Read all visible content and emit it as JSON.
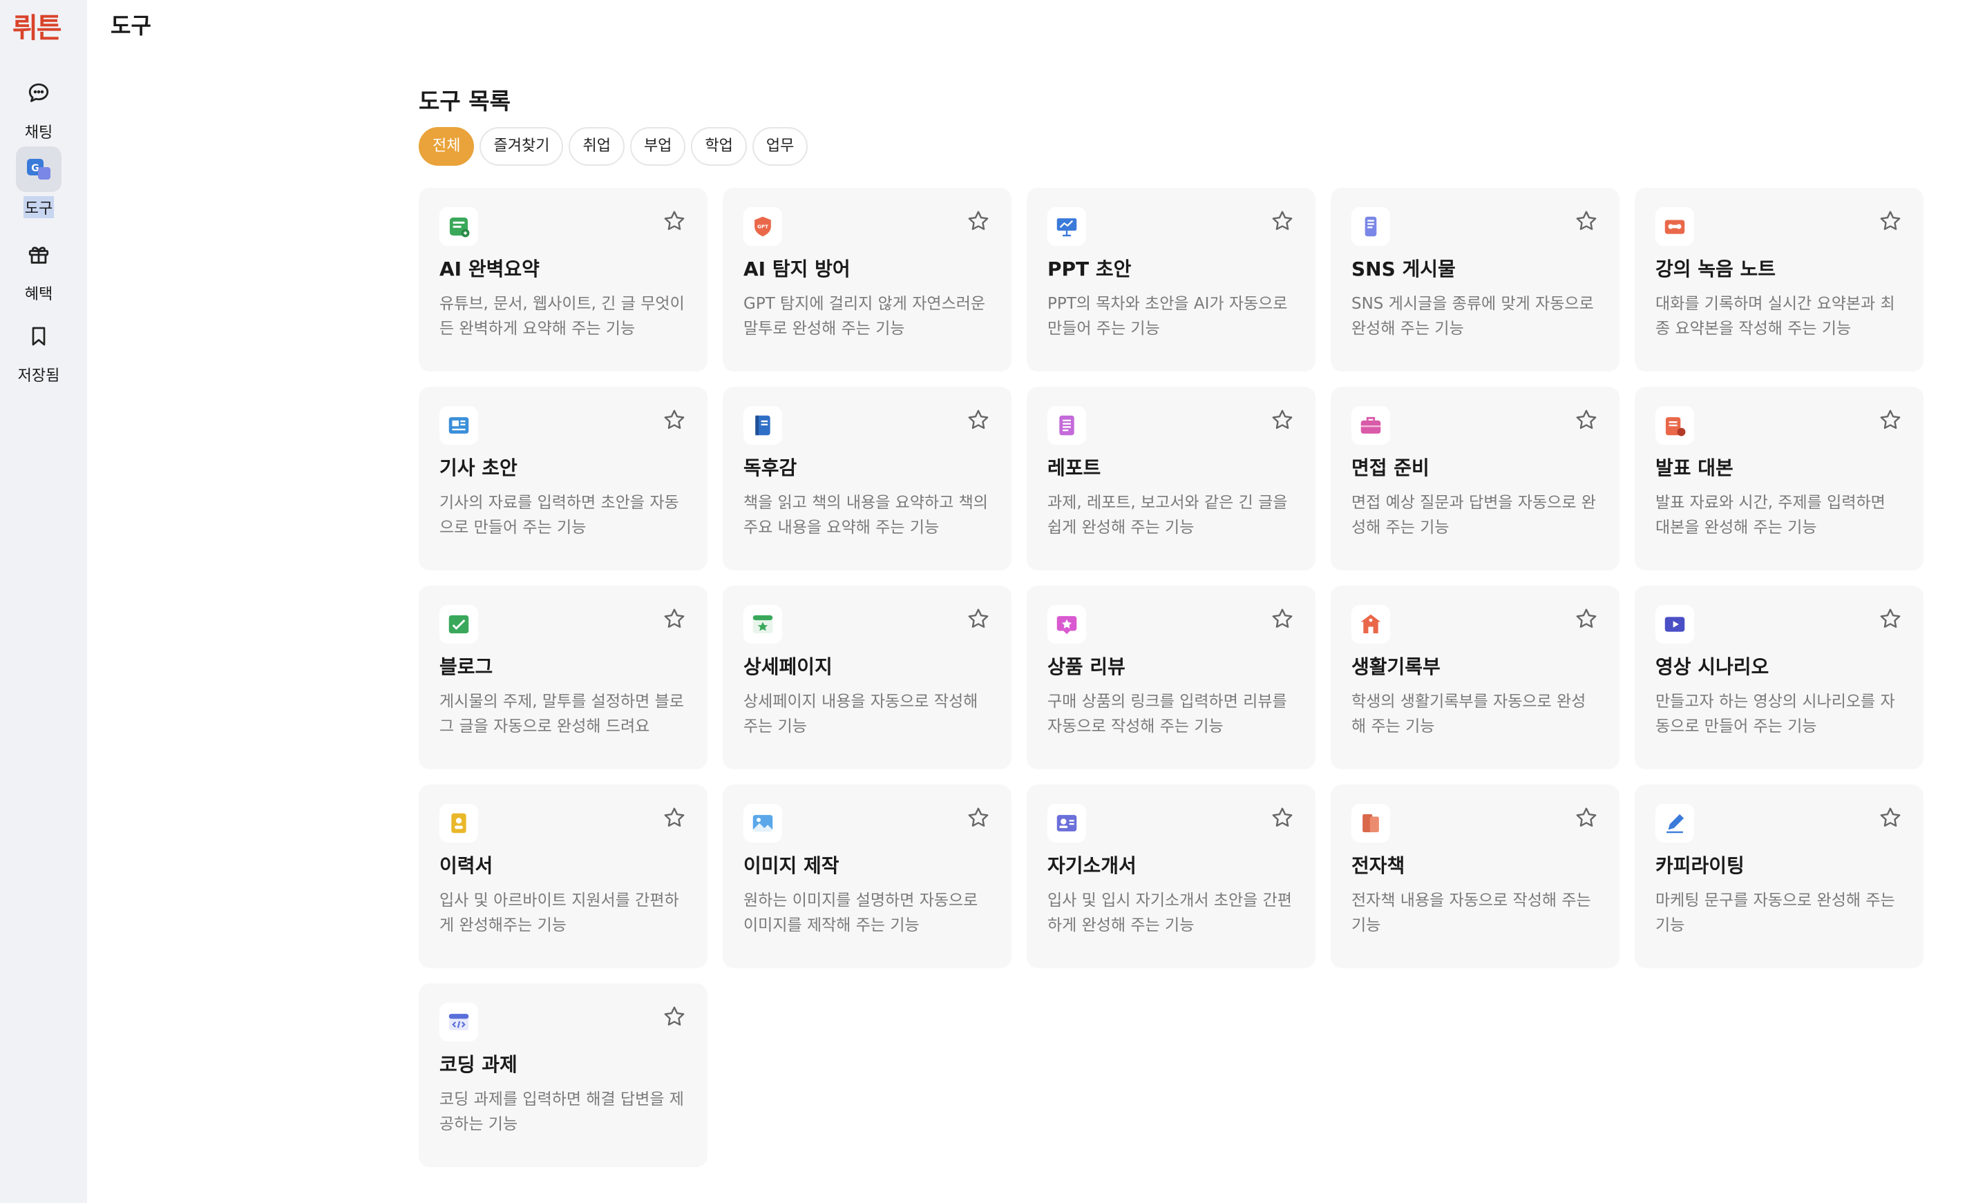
{
  "app": {
    "logo_text": "뤼튼",
    "page_title": "도구"
  },
  "sidebar": {
    "items": [
      {
        "label": "채팅",
        "icon": "chat-bubble-icon"
      },
      {
        "label": "도구",
        "icon": "tools-icon",
        "active": true
      },
      {
        "label": "혜택",
        "icon": "gift-icon"
      },
      {
        "label": "저장됨",
        "icon": "bookmark-icon"
      }
    ]
  },
  "main": {
    "section_title": "도구 목록",
    "filters": [
      "전체",
      "즐겨찾기",
      "취업",
      "부업",
      "학업",
      "업무"
    ],
    "active_filter": "전체",
    "cards": [
      {
        "title": "AI 완벽요약",
        "desc": "유튜브, 문서, 웹사이트, 긴 글 무엇이든 완벽하게 요약해 주는 기능",
        "icon": "summary-icon",
        "color": "#3aa85a"
      },
      {
        "title": "AI 탐지 방어",
        "desc": "GPT 탐지에 걸리지 않게 자연스러운 말투로 완성해 주는 기능",
        "icon": "gpt-shield-icon",
        "color": "#e9684a"
      },
      {
        "title": "PPT 초안",
        "desc": "PPT의 목차와 초안을 AI가 자동으로 만들어 주는 기능",
        "icon": "presentation-icon",
        "color": "#3a7ad9"
      },
      {
        "title": "SNS 게시물",
        "desc": "SNS 게시글을 종류에 맞게 자동으로 완성해 주는 기능",
        "icon": "phone-icon",
        "color": "#7b87e6"
      },
      {
        "title": "강의 녹음 노트",
        "desc": "대화를 기록하며 실시간 요약본과 최종 요약본을 작성해 주는 기능",
        "icon": "cassette-icon",
        "color": "#e9684a"
      },
      {
        "title": "기사 초안",
        "desc": "기사의 자료를 입력하면 초안을 자동으로 만들어 주는 기능",
        "icon": "newspaper-icon",
        "color": "#3a8fd9"
      },
      {
        "title": "독후감",
        "desc": "책을 읽고 책의 내용을 요약하고 책의 주요 내용을 요약해 주는 기능",
        "icon": "book-icon",
        "color": "#2f6fc6"
      },
      {
        "title": "레포트",
        "desc": "과제, 레포트, 보고서와 같은 긴 글을 쉽게 완성해 주는 기능",
        "icon": "report-icon",
        "color": "#c46ad9"
      },
      {
        "title": "면접 준비",
        "desc": "면접 예상 질문과 답변을 자동으로 완성해 주는 기능",
        "icon": "briefcase-icon",
        "color": "#d95aa8"
      },
      {
        "title": "발표 대본",
        "desc": "발표 자료와 시간, 주제를 입력하면 대본을 완성해 주는 기능",
        "icon": "script-icon",
        "color": "#e9684a"
      },
      {
        "title": "블로그",
        "desc": "게시물의 주제, 말투를 설정하면 블로그 글을 자동으로 완성해 드려요",
        "icon": "blog-icon",
        "color": "#3aa85a"
      },
      {
        "title": "상세페이지",
        "desc": "상세페이지 내용을 자동으로 작성해 주는 기능",
        "icon": "webpage-icon",
        "color": "#3aa85a"
      },
      {
        "title": "상품 리뷰",
        "desc": "구매 상품의 링크를 입력하면 리뷰를 자동으로 작성해 주는 기능",
        "icon": "review-icon",
        "color": "#d95ad0"
      },
      {
        "title": "생활기록부",
        "desc": "학생의 생활기록부를 자동으로 완성해 주는 기능",
        "icon": "school-icon",
        "color": "#e9684a"
      },
      {
        "title": "영상 시나리오",
        "desc": "만들고자 하는 영상의 시나리오를 자동으로 만들어 주는 기능",
        "icon": "video-icon",
        "color": "#4a4fc6"
      },
      {
        "title": "이력서",
        "desc": "입사 및 아르바이트 지원서를 간편하게 완성해주는 기능",
        "icon": "resume-icon",
        "color": "#e9b82a"
      },
      {
        "title": "이미지 제작",
        "desc": "원하는 이미지를 설명하면 자동으로 이미지를 제작해 주는 기능",
        "icon": "image-icon",
        "color": "#5aa8e9"
      },
      {
        "title": "자기소개서",
        "desc": "입사 및 입시 자기소개서 초안을 간편하게 완성해 주는 기능",
        "icon": "profile-card-icon",
        "color": "#6a6fd9"
      },
      {
        "title": "전자책",
        "desc": "전자책 내용을 자동으로 작성해 주는 기능",
        "icon": "ebook-icon",
        "color": "#d9684a"
      },
      {
        "title": "카피라이팅",
        "desc": "마케팅 문구를 자동으로 완성해 주는 기능",
        "icon": "pen-icon",
        "color": "#3a7ad9"
      },
      {
        "title": "코딩 과제",
        "desc": "코딩 과제를 입력하면 해결 답변을 제공하는 기능",
        "icon": "code-icon",
        "color": "#5a6fd9"
      }
    ]
  }
}
